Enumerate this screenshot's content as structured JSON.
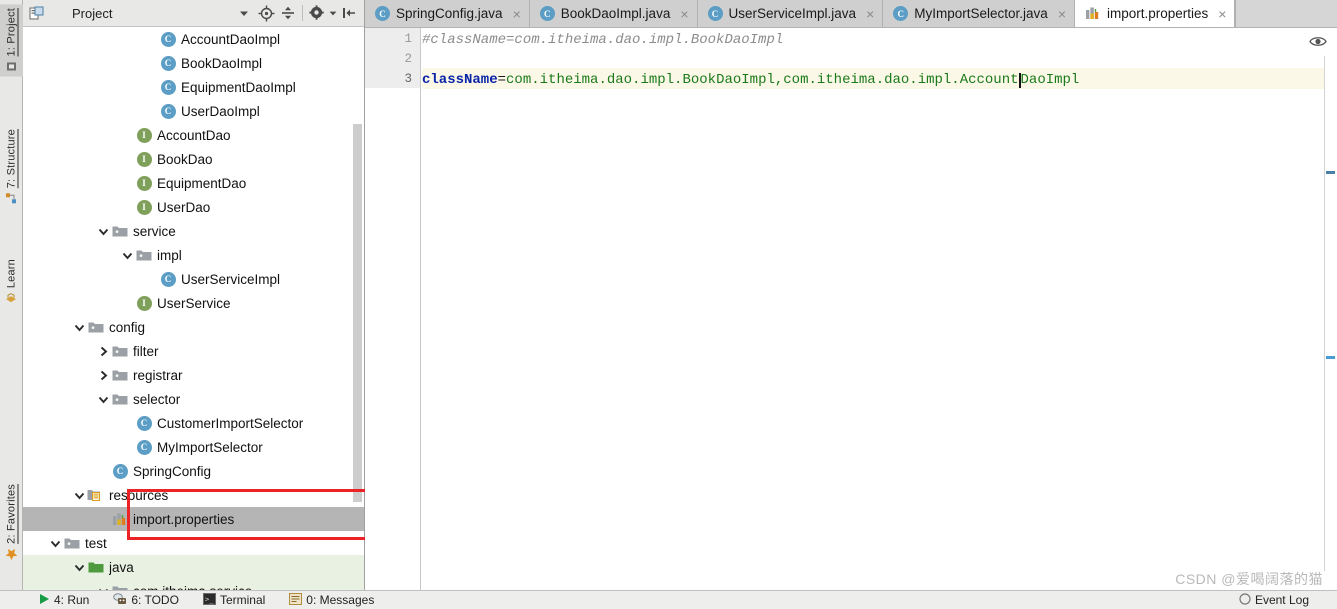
{
  "left_strip": {
    "tabs": [
      {
        "label": "1: Project",
        "icon": "project-icon",
        "selected": true
      },
      {
        "label": "7: Structure",
        "icon": "structure-icon",
        "selected": false
      },
      {
        "label": "Learn",
        "icon": "learn-icon",
        "selected": false
      },
      {
        "label": "2: Favorites",
        "icon": "star-icon",
        "selected": false
      }
    ]
  },
  "project_panel": {
    "title": "Project",
    "toolbar": {
      "dropdown": "chevron-down-icon",
      "locate": "locate-target-icon",
      "collapse_all": "collapse-all-icon",
      "settings": "gear-icon",
      "settings_dropdown": "chevron-down-icon",
      "hide": "hide-panel-icon"
    },
    "tree": [
      {
        "label": "AccountDaoImpl",
        "icon": "class-icon",
        "indent": 5,
        "arrow": "none",
        "state": "normal"
      },
      {
        "label": "BookDaoImpl",
        "icon": "class-icon",
        "indent": 5,
        "arrow": "none",
        "state": "normal"
      },
      {
        "label": "EquipmentDaoImpl",
        "icon": "class-icon",
        "indent": 5,
        "arrow": "none",
        "state": "normal"
      },
      {
        "label": "UserDaoImpl",
        "icon": "class-icon",
        "indent": 5,
        "arrow": "none",
        "state": "normal"
      },
      {
        "label": "AccountDao",
        "icon": "interface-icon",
        "indent": 4,
        "arrow": "none",
        "state": "normal"
      },
      {
        "label": "BookDao",
        "icon": "interface-icon",
        "indent": 4,
        "arrow": "none",
        "state": "normal"
      },
      {
        "label": "EquipmentDao",
        "icon": "interface-icon",
        "indent": 4,
        "arrow": "none",
        "state": "normal"
      },
      {
        "label": "UserDao",
        "icon": "interface-icon",
        "indent": 4,
        "arrow": "none",
        "state": "normal"
      },
      {
        "label": "service",
        "icon": "folder-icon",
        "indent": 3,
        "arrow": "expanded",
        "state": "normal"
      },
      {
        "label": "impl",
        "icon": "folder-icon",
        "indent": 4,
        "arrow": "expanded",
        "state": "normal"
      },
      {
        "label": "UserServiceImpl",
        "icon": "class-icon",
        "indent": 5,
        "arrow": "none",
        "state": "normal"
      },
      {
        "label": "UserService",
        "icon": "interface-icon",
        "indent": 4,
        "arrow": "none",
        "state": "normal"
      },
      {
        "label": "config",
        "icon": "folder-icon",
        "indent": 2,
        "arrow": "expanded",
        "state": "normal"
      },
      {
        "label": "filter",
        "icon": "folder-icon",
        "indent": 3,
        "arrow": "collapsed",
        "state": "normal"
      },
      {
        "label": "registrar",
        "icon": "folder-icon",
        "indent": 3,
        "arrow": "collapsed",
        "state": "normal"
      },
      {
        "label": "selector",
        "icon": "folder-icon",
        "indent": 3,
        "arrow": "expanded",
        "state": "normal"
      },
      {
        "label": "CustomerImportSelector",
        "icon": "class-icon",
        "indent": 4,
        "arrow": "none",
        "state": "normal"
      },
      {
        "label": "MyImportSelector",
        "icon": "class-icon",
        "indent": 4,
        "arrow": "none",
        "state": "normal"
      },
      {
        "label": "SpringConfig",
        "icon": "class-icon",
        "indent": 3,
        "arrow": "none",
        "state": "normal"
      },
      {
        "label": "resources",
        "icon": "resources-folder-icon",
        "indent": 2,
        "arrow": "expanded",
        "state": "normal"
      },
      {
        "label": "import.properties",
        "icon": "properties-icon",
        "indent": 3,
        "arrow": "none",
        "state": "selected"
      },
      {
        "label": "test",
        "icon": "folder-icon",
        "indent": 1,
        "arrow": "expanded",
        "state": "normal"
      },
      {
        "label": "java",
        "icon": "source-folder-icon",
        "indent": 2,
        "arrow": "expanded",
        "state": "green"
      },
      {
        "label": "com.itheima.service",
        "icon": "folder-icon",
        "indent": 3,
        "arrow": "expanded",
        "state": "green"
      }
    ]
  },
  "editor": {
    "tabs": [
      {
        "label": "SpringConfig.java",
        "icon": "class-icon",
        "active": false,
        "close": "×"
      },
      {
        "label": "BookDaoImpl.java",
        "icon": "class-icon",
        "active": false,
        "close": "×"
      },
      {
        "label": "UserServiceImpl.java",
        "icon": "class-icon",
        "active": false,
        "close": "×"
      },
      {
        "label": "MyImportSelector.java",
        "icon": "class-icon",
        "active": false,
        "close": "×"
      },
      {
        "label": "import.properties",
        "icon": "properties-icon",
        "active": true,
        "close": "×"
      }
    ],
    "line_numbers": [
      "1",
      "2",
      "3"
    ],
    "current_line": 3,
    "lines": [
      {
        "n": 1,
        "type": "comment",
        "text": "#className=com.itheima.dao.impl.BookDaoImpl"
      },
      {
        "n": 2,
        "type": "blank",
        "text": ""
      },
      {
        "n": 3,
        "type": "code",
        "key": "className",
        "equals": "=",
        "value_before_caret": "com.itheima.dao.impl.BookDaoImpl,com.itheima.dao.impl.Account",
        "value_after_caret": "DaoImpl"
      }
    ],
    "eye_icon": "eye-icon"
  },
  "statusbar": {
    "items": [
      {
        "label": "4: Run",
        "icon": "run-icon"
      },
      {
        "label": "6: TODO",
        "icon": "todo-icon"
      },
      {
        "label": "Terminal",
        "icon": "terminal-icon"
      },
      {
        "label": "0: Messages",
        "icon": "messages-icon"
      }
    ],
    "right_label": "Event Log",
    "right_icon": "event-log-icon"
  },
  "watermark": "CSDN @爱喝阔落的猫",
  "colors": {
    "accent_blue": "#5b9dc4",
    "interface_green": "#7fa05a",
    "annotation_red": "#ec2227",
    "selection_gray": "#b5b5b5",
    "current_line": "#fcf8e8",
    "string_green": "#1a7a1a",
    "keyword_blue": "#0a25a8"
  }
}
